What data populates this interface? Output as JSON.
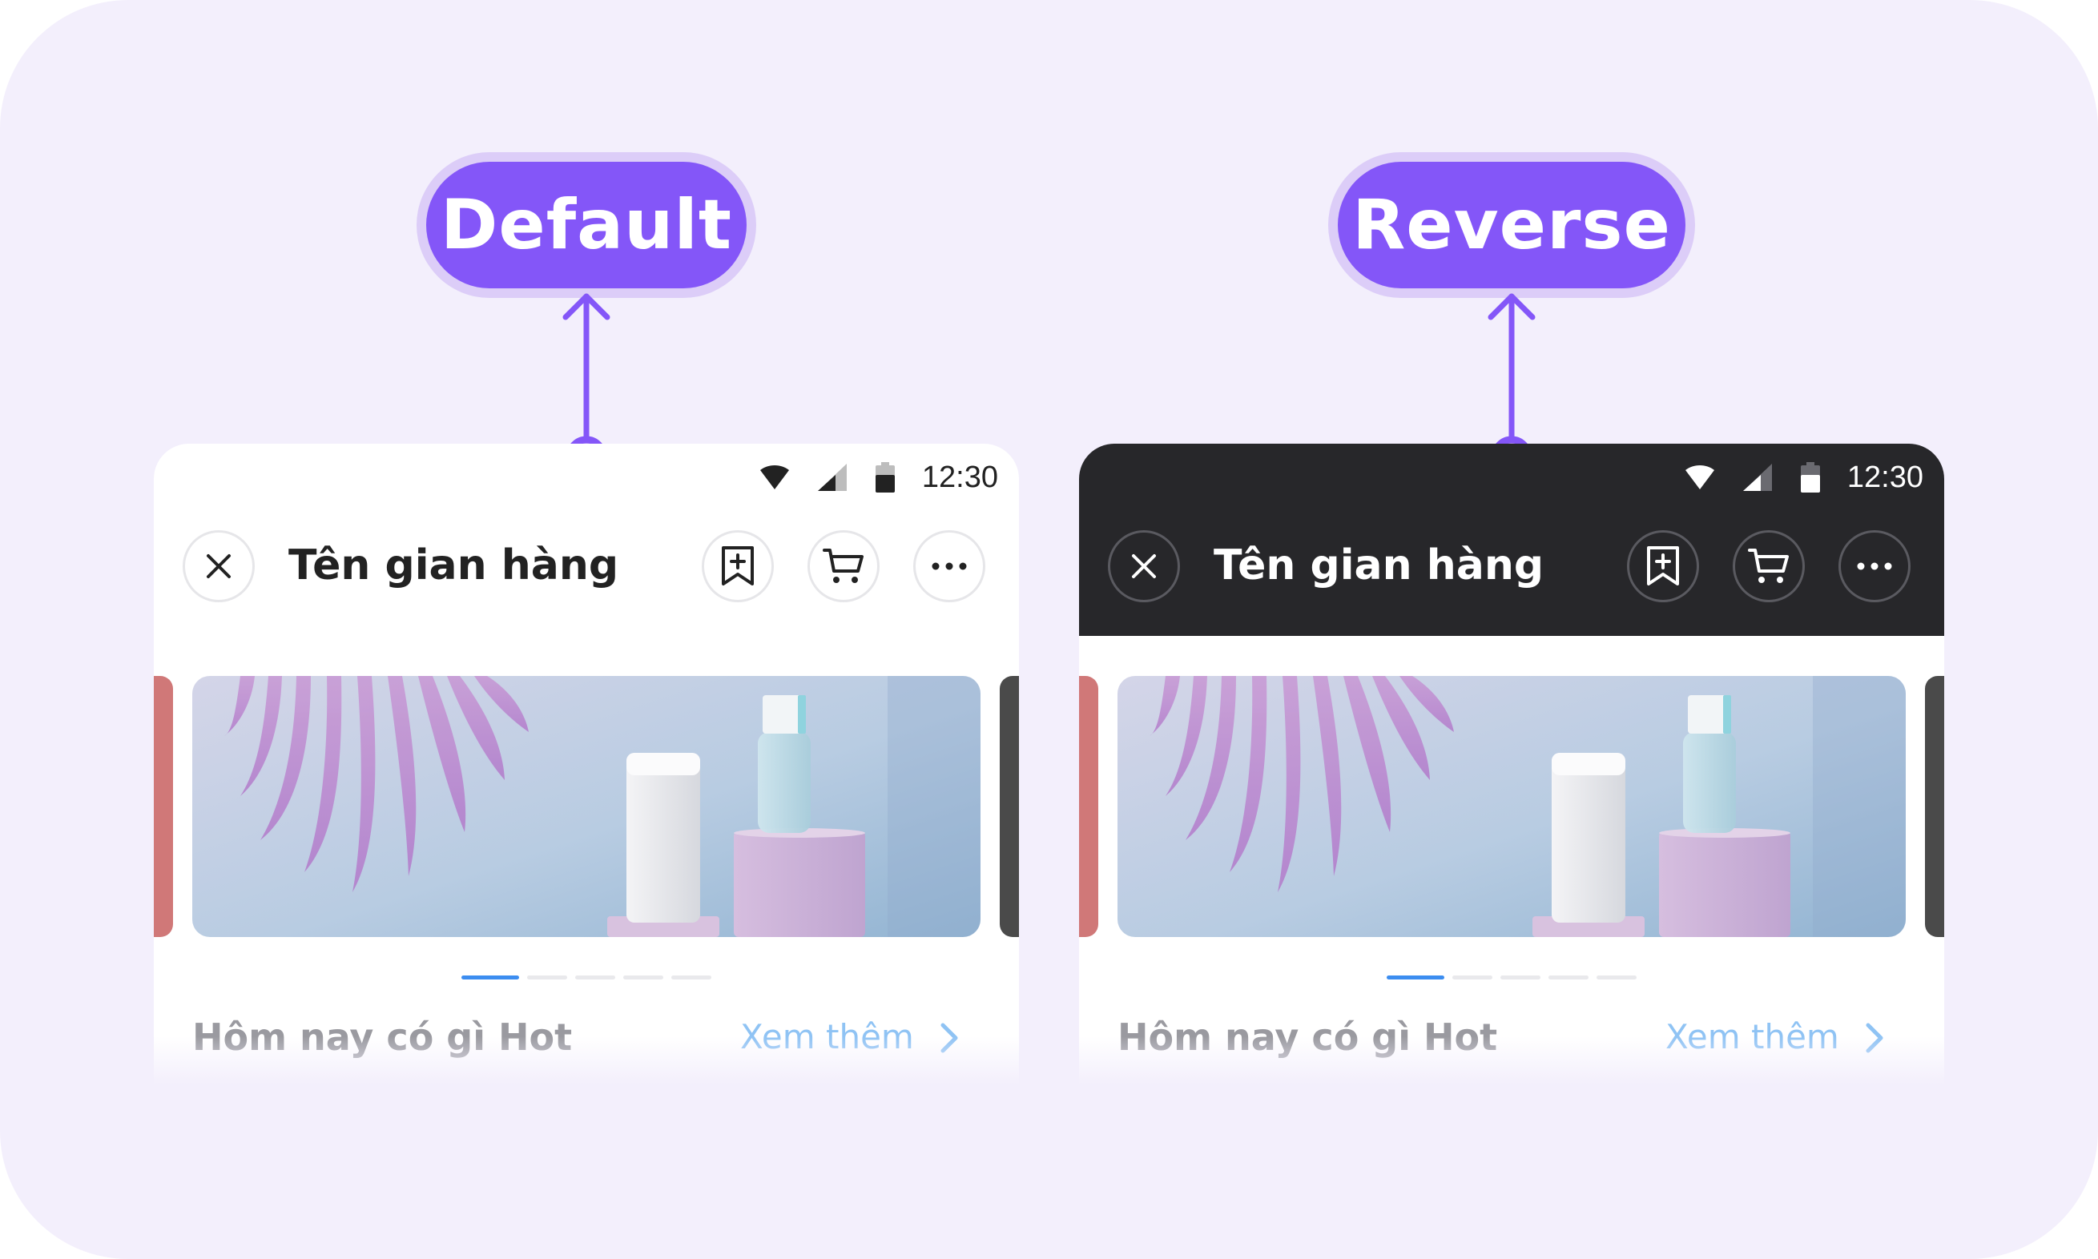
{
  "labels": {
    "default": "Default",
    "reverse": "Reverse"
  },
  "colors": {
    "background": "#F3EFFC",
    "accent": "#8456F8",
    "accent_halo": "#DCCDF8",
    "reverse_header": "#27272A",
    "active_dot": "#3C8DF0",
    "see_more": "#8FC3F4"
  },
  "screens": [
    {
      "variant": "default",
      "status_bar": {
        "time": "12:30",
        "icons": [
          "wifi-icon",
          "signal-icon",
          "battery-icon"
        ]
      },
      "header": {
        "close_icon": "close-icon",
        "title": "Tên gian hàng",
        "actions": [
          "bookmark-add-icon",
          "cart-icon",
          "more-icon"
        ]
      },
      "banner": {
        "image": "cosmetic-bottles-with-palm-leaves"
      },
      "carousel": {
        "pages": 5,
        "active_index": 0
      },
      "section": {
        "title": "Hôm nay có gì Hot",
        "see_more": "Xem thêm"
      }
    },
    {
      "variant": "reverse",
      "status_bar": {
        "time": "12:30",
        "icons": [
          "wifi-icon",
          "signal-icon",
          "battery-icon"
        ]
      },
      "header": {
        "close_icon": "close-icon",
        "title": "Tên gian hàng",
        "actions": [
          "bookmark-add-icon",
          "cart-icon",
          "more-icon"
        ]
      },
      "banner": {
        "image": "cosmetic-bottles-with-palm-leaves"
      },
      "carousel": {
        "pages": 5,
        "active_index": 0
      },
      "section": {
        "title": "Hôm nay có gì Hot",
        "see_more": "Xem thêm"
      }
    }
  ]
}
